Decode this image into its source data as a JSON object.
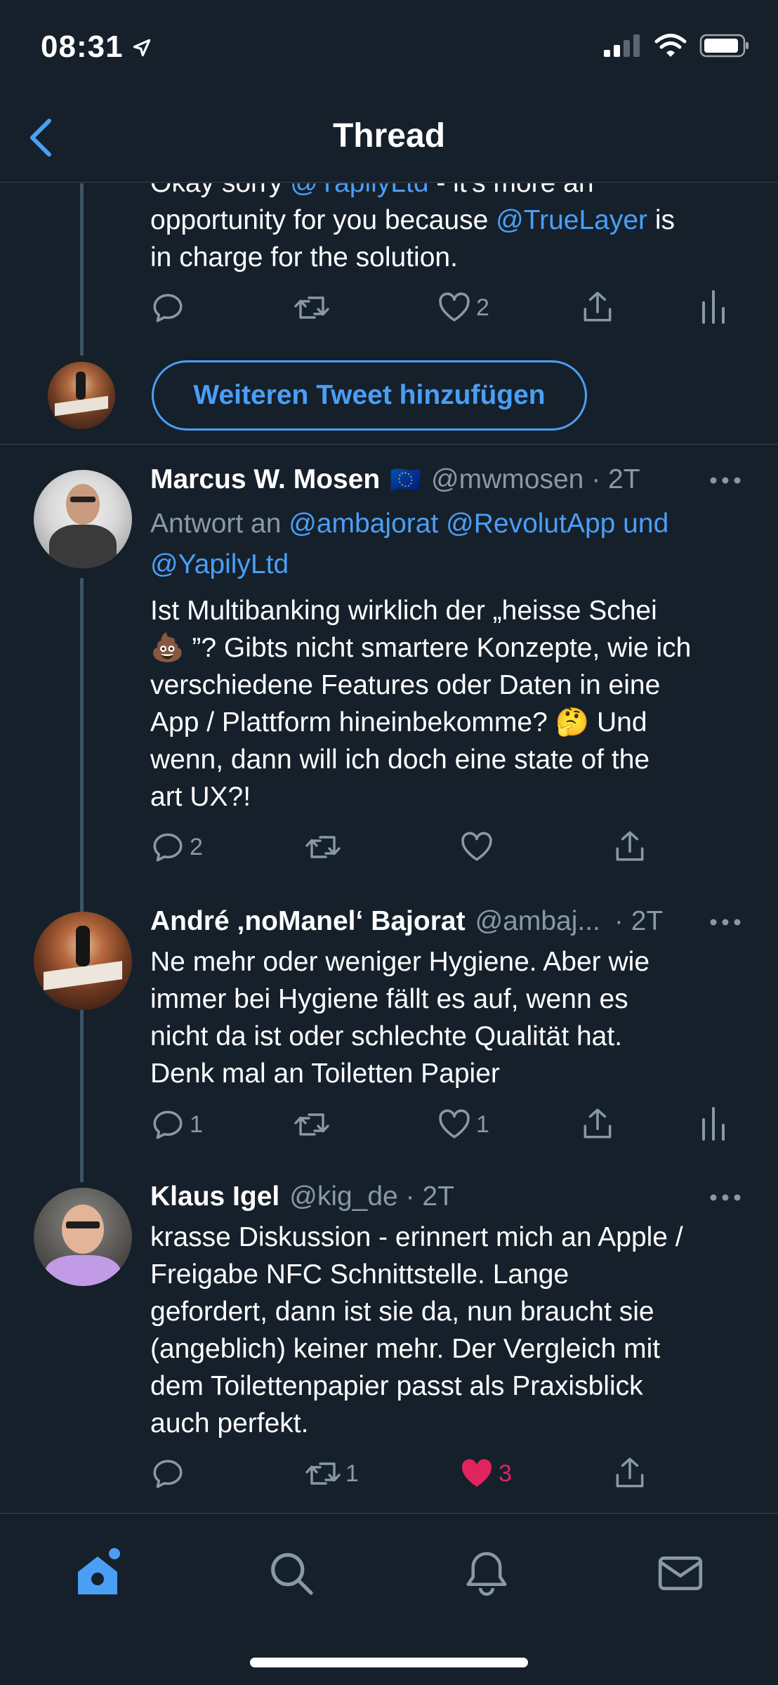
{
  "status_bar": {
    "time": "08:31"
  },
  "nav": {
    "title": "Thread"
  },
  "tweet0": {
    "line1_pre": "Okay sorry ",
    "line1_mention": "@YapilyLtd",
    "line1_post": " - it's more an",
    "line2_pre": "opportunity for you because ",
    "line2_mention": "@TrueLayer",
    "line2_post": " is",
    "line3": "in charge for the solution.",
    "likes": "2"
  },
  "add_tweet": {
    "label": "Weiteren Tweet hinzufügen"
  },
  "tweet1": {
    "name": "Marcus W. Mosen",
    "flag": "🇪🇺",
    "handle": "@mwmosen · 2T",
    "reply_prefix": "Antwort an ",
    "reply_mentions_1": "@ambajorat @RevolutApp und",
    "reply_mentions_2": "@YapilyLtd",
    "lines": [
      "Ist Multibanking wirklich der „heisse Schei",
      "💩 ”? Gibts nicht smartere Konzepte, wie ich",
      "verschiedene Features oder Daten in eine",
      "App / Plattform hineinbekomme? 🤔 Und",
      "wenn, dann will ich doch eine state of the",
      "art UX?!"
    ],
    "replies": "2"
  },
  "tweet2": {
    "name": "André ‚noManel‘ Bajorat",
    "handle": "@ambaj...",
    "time": "· 2T",
    "lines": [
      "Ne mehr oder weniger Hygiene. Aber wie",
      "immer bei Hygiene fällt es auf, wenn es",
      "nicht da ist oder schlechte Qualität hat.",
      "Denk mal an Toiletten Papier"
    ],
    "replies": "1",
    "likes": "1"
  },
  "tweet3": {
    "name": "Klaus Igel",
    "handle": "@kig_de · 2T",
    "lines": [
      "krasse Diskussion - erinnert mich an Apple /",
      "Freigabe NFC Schnittstelle. Lange",
      "gefordert, dann ist sie da, nun braucht sie",
      "(angeblich) keiner mehr. Der Vergleich mit",
      "dem Toilettenpapier passt als Praxisblick",
      "auch perfekt."
    ],
    "retweets": "1",
    "likes": "3"
  },
  "colors": {
    "background": "#15202b",
    "accent": "#4a9ff5",
    "muted": "#8899a6",
    "like": "#e0245e",
    "thread_line": "#3d5466"
  },
  "icons": {
    "reply": "reply-icon",
    "retweet": "retweet-icon",
    "like": "heart-icon",
    "share": "share-icon",
    "analytics": "analytics-icon",
    "more": "more-icon",
    "tabs": [
      "home-icon",
      "search-icon",
      "bell-icon",
      "mail-icon"
    ]
  }
}
